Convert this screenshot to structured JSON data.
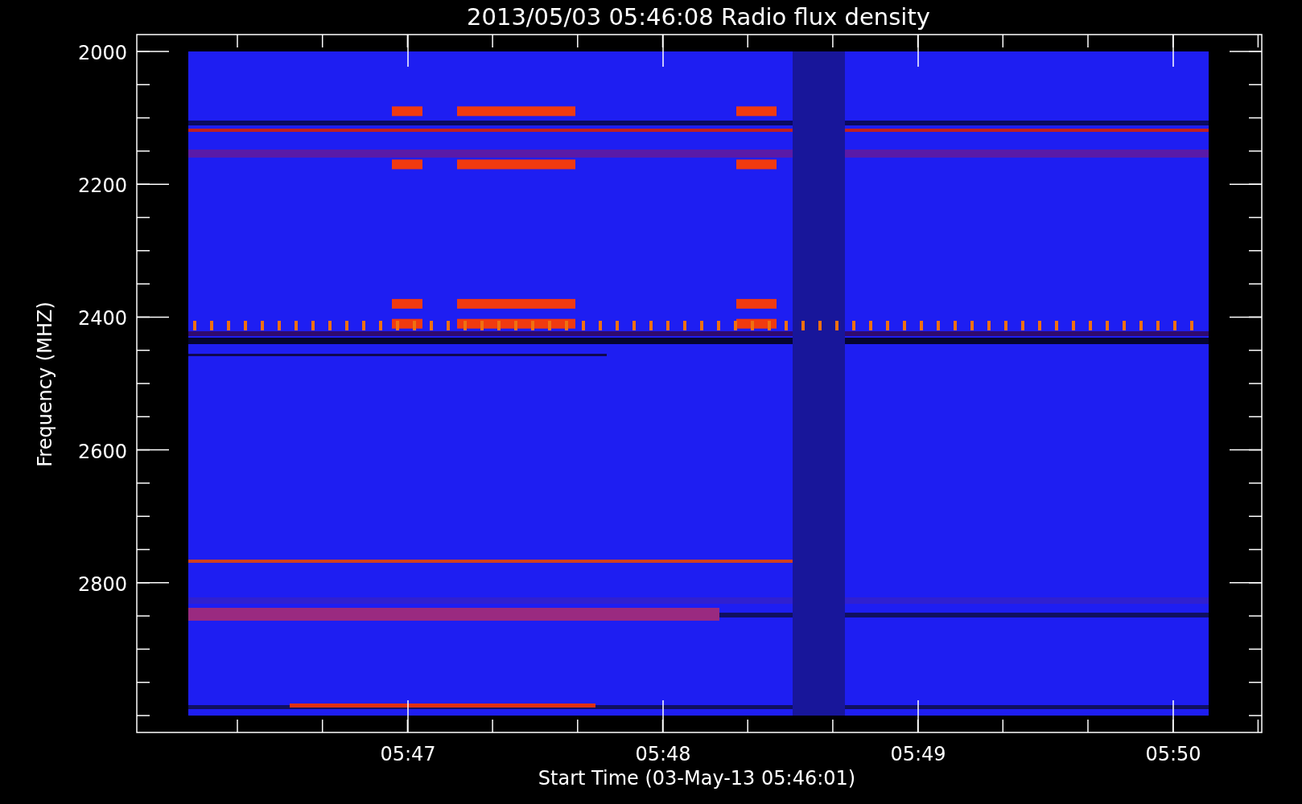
{
  "plot": {
    "title": "2013/05/03 05:46:08 Radio flux density",
    "y_axis": {
      "label": "Frequency (MHZ)",
      "ticks": [
        "2000",
        "2200",
        "2400",
        "2600",
        "2800"
      ]
    },
    "x_axis": {
      "label": "Start Time (03-May-13 05:46:01)",
      "ticks": [
        "05:47",
        "05:48",
        "05:49",
        "05:50"
      ]
    }
  }
}
